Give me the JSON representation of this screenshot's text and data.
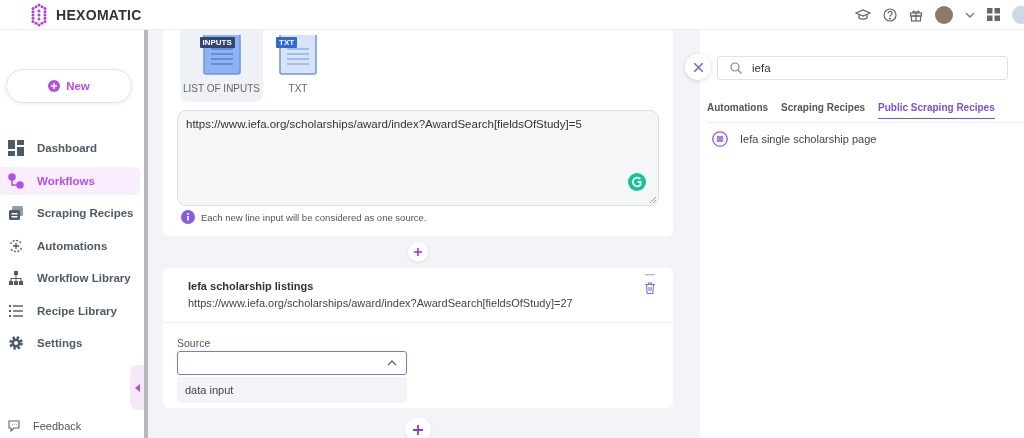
{
  "brand": {
    "name": "HEXOMATIC"
  },
  "sidebar": {
    "new_button": "New",
    "items": [
      {
        "label": "Dashboard",
        "selected": false
      },
      {
        "label": "Workflows",
        "selected": true
      },
      {
        "label": "Scraping Recipes",
        "selected": false
      },
      {
        "label": "Automations",
        "selected": false
      },
      {
        "label": "Workflow Library",
        "selected": false
      },
      {
        "label": "Recipe Library",
        "selected": false
      },
      {
        "label": "Settings",
        "selected": false
      }
    ],
    "feedback": "Feedback"
  },
  "input_types": [
    {
      "badge": "INPUTS",
      "label": "LIST OF INPUTS",
      "selected": true
    },
    {
      "badge": "TXT",
      "label": "TXT",
      "selected": false
    }
  ],
  "input_text": {
    "value": "https://www.iefa.org/scholarships/award/index?AwardSearch[fieldsOfStudy]=5"
  },
  "hint": "Each new line input will be considered as one source.",
  "step": {
    "title": "Iefa scholarship listings",
    "url": "https://www.iefa.org/scholarships/award/index?AwardSearch[fieldsOfStudy]=27"
  },
  "source": {
    "label": "Source",
    "expanded": true,
    "options": [
      "data input"
    ]
  },
  "search": {
    "value": "iefa"
  },
  "tabs": [
    {
      "label": "Automations",
      "selected": false
    },
    {
      "label": "Scraping Recipes",
      "selected": false
    },
    {
      "label": "Public Scraping Recipes",
      "selected": true
    }
  ],
  "results": [
    {
      "label": "Iefa single scholarship page"
    }
  ]
}
